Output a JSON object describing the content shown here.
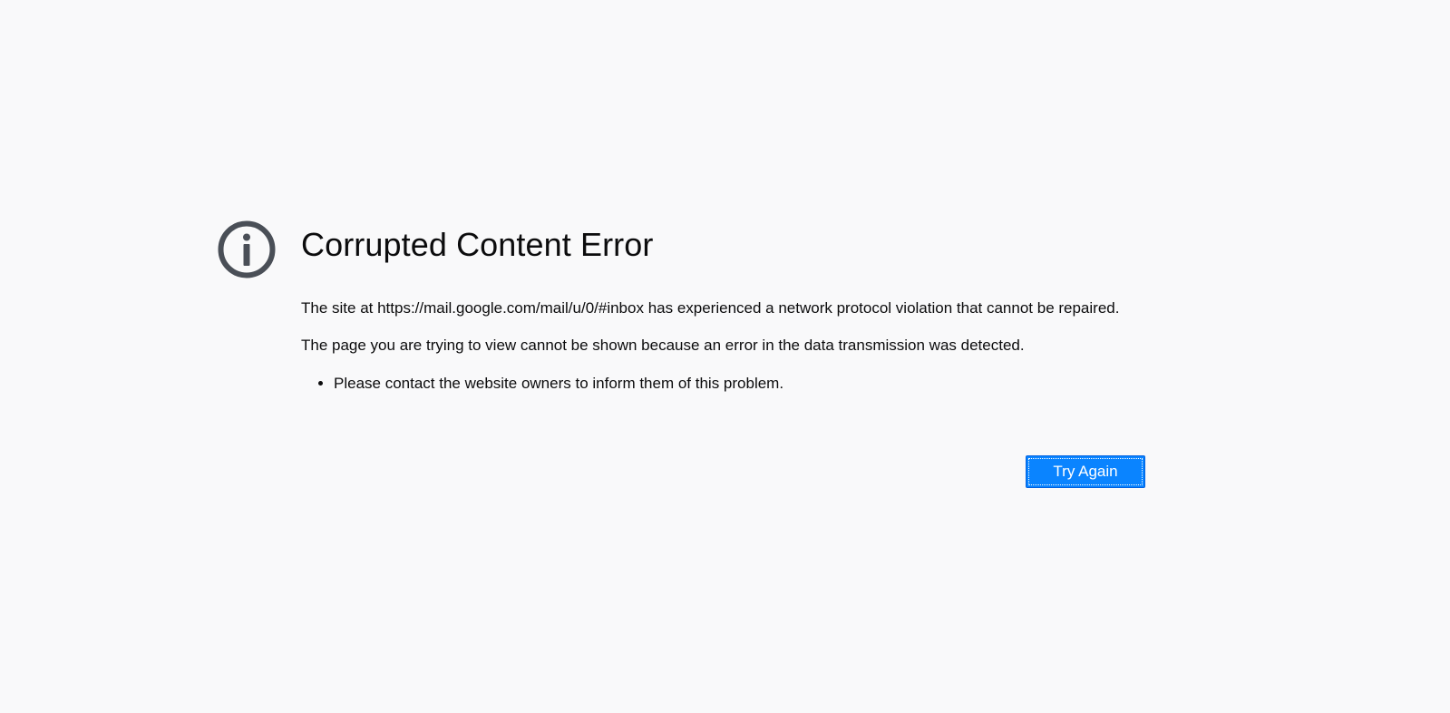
{
  "error": {
    "icon": "info-icon",
    "title": "Corrupted Content Error",
    "intro": "The site at https://mail.google.com/mail/u/0/#inbox has experienced a network protocol violation that cannot be repaired.",
    "description": "The page you are trying to view cannot be shown because an error in the data transmission was detected.",
    "bullets": [
      "Please contact the website owners to inform them of this problem."
    ]
  },
  "actions": {
    "try_again_label": "Try Again"
  },
  "colors": {
    "background": "#f9f9fa",
    "icon": "#4a4f57",
    "button": "#0a84ff"
  }
}
